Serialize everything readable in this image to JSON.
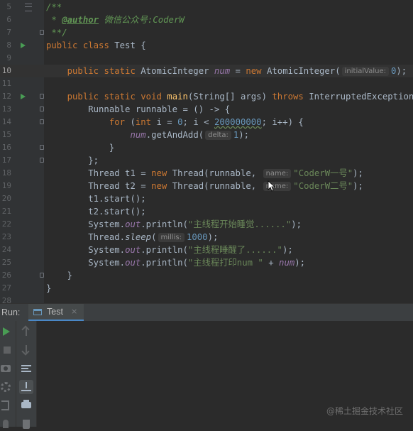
{
  "editor": {
    "lines": [
      {
        "n": "5",
        "tokens": [
          {
            "t": "/**",
            "c": "cmt"
          }
        ]
      },
      {
        "n": "6",
        "tokens": [
          {
            "t": " * ",
            "c": "cmt"
          },
          {
            "t": "@author",
            "c": "tag"
          },
          {
            "t": " 微信公众号:CoderW",
            "c": "cmt"
          }
        ]
      },
      {
        "n": "7",
        "tokens": [
          {
            "t": " **/",
            "c": "cmt"
          }
        ]
      },
      {
        "n": "8",
        "tokens": [
          {
            "t": "public ",
            "c": "kw"
          },
          {
            "t": "class ",
            "c": "kw"
          },
          {
            "t": "Test {"
          }
        ]
      },
      {
        "n": "9",
        "tokens": []
      },
      {
        "n": "10",
        "tokens": [
          {
            "t": "    public ",
            "c": "kw"
          },
          {
            "t": "static ",
            "c": "kw"
          },
          {
            "t": "AtomicInteger "
          },
          {
            "t": "num",
            "c": "fld"
          },
          {
            "t": " = "
          },
          {
            "t": "new ",
            "c": "kw"
          },
          {
            "t": "AtomicInteger("
          },
          {
            "hint": "initialValue:"
          },
          {
            "t": "0",
            "c": "num"
          },
          {
            "t": ");"
          }
        ]
      },
      {
        "n": "11",
        "tokens": []
      },
      {
        "n": "12",
        "tokens": [
          {
            "t": "    public ",
            "c": "kw"
          },
          {
            "t": "static ",
            "c": "kw"
          },
          {
            "t": "void ",
            "c": "kw"
          },
          {
            "t": "main",
            "c": "mth"
          },
          {
            "t": "(String[] args) "
          },
          {
            "t": "throws ",
            "c": "kw"
          },
          {
            "t": "InterruptedException {"
          }
        ]
      },
      {
        "n": "13",
        "tokens": [
          {
            "t": "        Runnable runnable = () -> {"
          }
        ]
      },
      {
        "n": "14",
        "tokens": [
          {
            "t": "            "
          },
          {
            "t": "for ",
            "c": "kw"
          },
          {
            "t": "("
          },
          {
            "t": "int ",
            "c": "kw"
          },
          {
            "t": "i = "
          },
          {
            "t": "0",
            "c": "num"
          },
          {
            "t": "; i < "
          },
          {
            "t": "200000000",
            "c": "num wavy"
          },
          {
            "t": "; i++) {"
          }
        ]
      },
      {
        "n": "15",
        "tokens": [
          {
            "t": "                "
          },
          {
            "t": "num",
            "c": "fld"
          },
          {
            "t": ".getAndAdd("
          },
          {
            "hint": "delta:"
          },
          {
            "t": "1",
            "c": "num"
          },
          {
            "t": ");"
          }
        ]
      },
      {
        "n": "16",
        "tokens": [
          {
            "t": "            }"
          }
        ]
      },
      {
        "n": "17",
        "tokens": [
          {
            "t": "        };"
          }
        ]
      },
      {
        "n": "18",
        "tokens": [
          {
            "t": "        Thread t1 = "
          },
          {
            "t": "new ",
            "c": "kw"
          },
          {
            "t": "Thread(runnable, "
          },
          {
            "hint": "name:"
          },
          {
            "t": "\"CoderW一号\"",
            "c": "str"
          },
          {
            "t": ");"
          }
        ]
      },
      {
        "n": "19",
        "tokens": [
          {
            "t": "        Thread t2 = "
          },
          {
            "t": "new ",
            "c": "kw"
          },
          {
            "t": "Thread(runnable, "
          },
          {
            "hint": "name:"
          },
          {
            "t": "\"CoderW二号\"",
            "c": "str"
          },
          {
            "t": ");"
          }
        ]
      },
      {
        "n": "20",
        "tokens": [
          {
            "t": "        t1.start();"
          }
        ]
      },
      {
        "n": "21",
        "tokens": [
          {
            "t": "        t2.start();"
          }
        ]
      },
      {
        "n": "22",
        "tokens": [
          {
            "t": "        System."
          },
          {
            "t": "out",
            "c": "fld"
          },
          {
            "t": ".println("
          },
          {
            "t": "\"主线程开始睡觉......\"",
            "c": "str"
          },
          {
            "t": ");"
          }
        ]
      },
      {
        "n": "23",
        "tokens": [
          {
            "t": "        Thread."
          },
          {
            "t": "sleep",
            "c": "stat"
          },
          {
            "t": "("
          },
          {
            "hint": "millis:"
          },
          {
            "t": "1000",
            "c": "num"
          },
          {
            "t": ");"
          }
        ]
      },
      {
        "n": "24",
        "tokens": [
          {
            "t": "        System."
          },
          {
            "t": "out",
            "c": "fld"
          },
          {
            "t": ".println("
          },
          {
            "t": "\"主线程睡醒了......\"",
            "c": "str"
          },
          {
            "t": ");"
          }
        ]
      },
      {
        "n": "25",
        "tokens": [
          {
            "t": "        System."
          },
          {
            "t": "out",
            "c": "fld"
          },
          {
            "t": ".println("
          },
          {
            "t": "\"主线程打印num \"",
            "c": "str"
          },
          {
            "t": " + "
          },
          {
            "t": "num",
            "c": "fld"
          },
          {
            "t": ");"
          }
        ]
      },
      {
        "n": "26",
        "tokens": [
          {
            "t": "    }"
          }
        ]
      },
      {
        "n": "27",
        "tokens": [
          {
            "t": "}"
          }
        ]
      },
      {
        "n": "28",
        "tokens": []
      }
    ],
    "current_line": "10",
    "run_gutter_lines": [
      "8",
      "12"
    ]
  },
  "run_panel": {
    "label": "Run:",
    "tab_label": "Test",
    "tab_close": "×"
  },
  "watermark": "@稀土掘金技术社区",
  "colors": {
    "editor_bg": "#2b2b2b",
    "keyword": "#cc7832",
    "string": "#6a8759",
    "number": "#6897bb",
    "field": "#9876aa",
    "method": "#ffc66d",
    "run_green": "#499c54"
  },
  "icons": {
    "run_gutter": "run-gutter-icon",
    "rerun": "play-icon",
    "stop": "stop-icon",
    "snapshot": "camera-icon",
    "settings": "gear-icon",
    "exit": "exit-icon",
    "pin": "pin-icon",
    "up": "arrow-up-icon",
    "down": "arrow-down-icon",
    "soft_wrap": "soft-wrap-icon",
    "scroll_end": "scroll-to-end-icon",
    "print": "print-icon",
    "clear": "trash-icon"
  }
}
